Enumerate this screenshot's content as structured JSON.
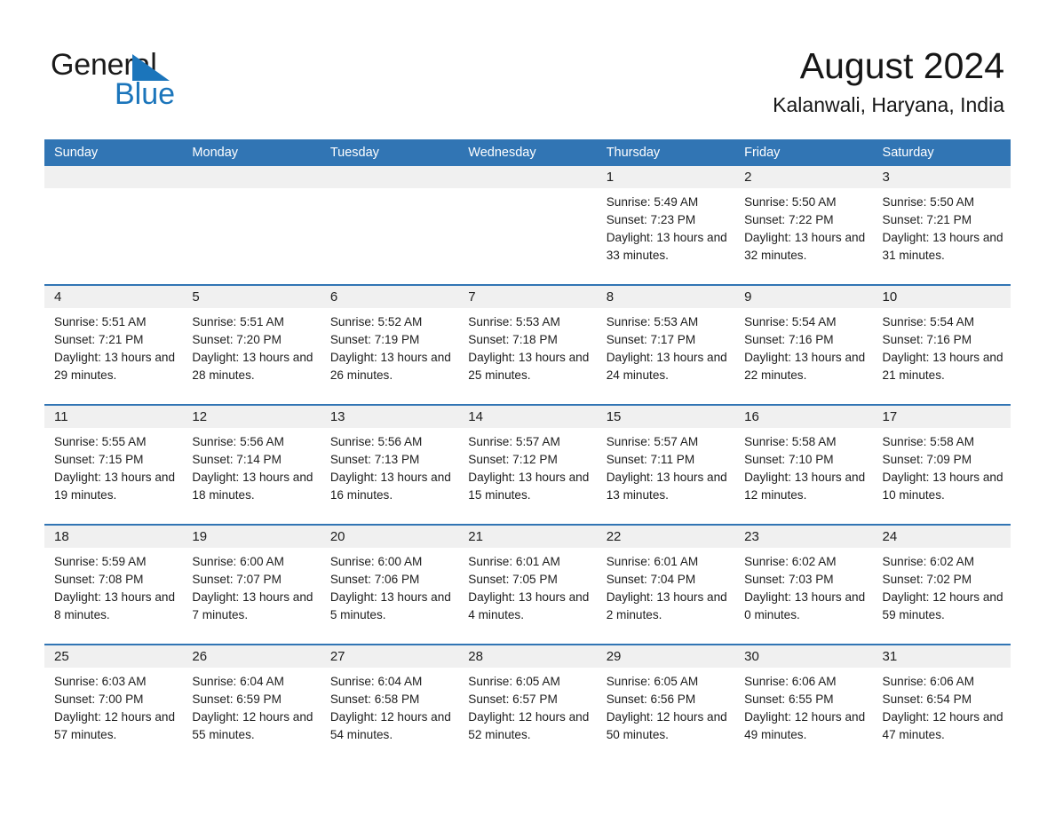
{
  "brand": {
    "name_part1": "General",
    "name_part2": "Blue",
    "triangle_icon": "triangle-icon",
    "accent_color": "#1b75bb"
  },
  "header": {
    "month_title": "August 2024",
    "location": "Kalanwali, Haryana, India"
  },
  "theme": {
    "header_blue": "#3175b4",
    "daynum_band": "#f0f0f0",
    "text": "#1d1d1d"
  },
  "calendar": {
    "weekday_headers": [
      "Sunday",
      "Monday",
      "Tuesday",
      "Wednesday",
      "Thursday",
      "Friday",
      "Saturday"
    ],
    "weeks": [
      [
        {
          "day": "",
          "empty": true,
          "info": ""
        },
        {
          "day": "",
          "empty": true,
          "info": ""
        },
        {
          "day": "",
          "empty": true,
          "info": ""
        },
        {
          "day": "",
          "empty": true,
          "info": ""
        },
        {
          "day": "1",
          "empty": false,
          "info": "Sunrise: 5:49 AM\nSunset: 7:23 PM\nDaylight: 13 hours and 33 minutes."
        },
        {
          "day": "2",
          "empty": false,
          "info": "Sunrise: 5:50 AM\nSunset: 7:22 PM\nDaylight: 13 hours and 32 minutes."
        },
        {
          "day": "3",
          "empty": false,
          "info": "Sunrise: 5:50 AM\nSunset: 7:21 PM\nDaylight: 13 hours and 31 minutes."
        }
      ],
      [
        {
          "day": "4",
          "empty": false,
          "info": "Sunrise: 5:51 AM\nSunset: 7:21 PM\nDaylight: 13 hours and 29 minutes."
        },
        {
          "day": "5",
          "empty": false,
          "info": "Sunrise: 5:51 AM\nSunset: 7:20 PM\nDaylight: 13 hours and 28 minutes."
        },
        {
          "day": "6",
          "empty": false,
          "info": "Sunrise: 5:52 AM\nSunset: 7:19 PM\nDaylight: 13 hours and 26 minutes."
        },
        {
          "day": "7",
          "empty": false,
          "info": "Sunrise: 5:53 AM\nSunset: 7:18 PM\nDaylight: 13 hours and 25 minutes."
        },
        {
          "day": "8",
          "empty": false,
          "info": "Sunrise: 5:53 AM\nSunset: 7:17 PM\nDaylight: 13 hours and 24 minutes."
        },
        {
          "day": "9",
          "empty": false,
          "info": "Sunrise: 5:54 AM\nSunset: 7:16 PM\nDaylight: 13 hours and 22 minutes."
        },
        {
          "day": "10",
          "empty": false,
          "info": "Sunrise: 5:54 AM\nSunset: 7:16 PM\nDaylight: 13 hours and 21 minutes."
        }
      ],
      [
        {
          "day": "11",
          "empty": false,
          "info": "Sunrise: 5:55 AM\nSunset: 7:15 PM\nDaylight: 13 hours and 19 minutes."
        },
        {
          "day": "12",
          "empty": false,
          "info": "Sunrise: 5:56 AM\nSunset: 7:14 PM\nDaylight: 13 hours and 18 minutes."
        },
        {
          "day": "13",
          "empty": false,
          "info": "Sunrise: 5:56 AM\nSunset: 7:13 PM\nDaylight: 13 hours and 16 minutes."
        },
        {
          "day": "14",
          "empty": false,
          "info": "Sunrise: 5:57 AM\nSunset: 7:12 PM\nDaylight: 13 hours and 15 minutes."
        },
        {
          "day": "15",
          "empty": false,
          "info": "Sunrise: 5:57 AM\nSunset: 7:11 PM\nDaylight: 13 hours and 13 minutes."
        },
        {
          "day": "16",
          "empty": false,
          "info": "Sunrise: 5:58 AM\nSunset: 7:10 PM\nDaylight: 13 hours and 12 minutes."
        },
        {
          "day": "17",
          "empty": false,
          "info": "Sunrise: 5:58 AM\nSunset: 7:09 PM\nDaylight: 13 hours and 10 minutes."
        }
      ],
      [
        {
          "day": "18",
          "empty": false,
          "info": "Sunrise: 5:59 AM\nSunset: 7:08 PM\nDaylight: 13 hours and 8 minutes."
        },
        {
          "day": "19",
          "empty": false,
          "info": "Sunrise: 6:00 AM\nSunset: 7:07 PM\nDaylight: 13 hours and 7 minutes."
        },
        {
          "day": "20",
          "empty": false,
          "info": "Sunrise: 6:00 AM\nSunset: 7:06 PM\nDaylight: 13 hours and 5 minutes."
        },
        {
          "day": "21",
          "empty": false,
          "info": "Sunrise: 6:01 AM\nSunset: 7:05 PM\nDaylight: 13 hours and 4 minutes."
        },
        {
          "day": "22",
          "empty": false,
          "info": "Sunrise: 6:01 AM\nSunset: 7:04 PM\nDaylight: 13 hours and 2 minutes."
        },
        {
          "day": "23",
          "empty": false,
          "info": "Sunrise: 6:02 AM\nSunset: 7:03 PM\nDaylight: 13 hours and 0 minutes."
        },
        {
          "day": "24",
          "empty": false,
          "info": "Sunrise: 6:02 AM\nSunset: 7:02 PM\nDaylight: 12 hours and 59 minutes."
        }
      ],
      [
        {
          "day": "25",
          "empty": false,
          "info": "Sunrise: 6:03 AM\nSunset: 7:00 PM\nDaylight: 12 hours and 57 minutes."
        },
        {
          "day": "26",
          "empty": false,
          "info": "Sunrise: 6:04 AM\nSunset: 6:59 PM\nDaylight: 12 hours and 55 minutes."
        },
        {
          "day": "27",
          "empty": false,
          "info": "Sunrise: 6:04 AM\nSunset: 6:58 PM\nDaylight: 12 hours and 54 minutes."
        },
        {
          "day": "28",
          "empty": false,
          "info": "Sunrise: 6:05 AM\nSunset: 6:57 PM\nDaylight: 12 hours and 52 minutes."
        },
        {
          "day": "29",
          "empty": false,
          "info": "Sunrise: 6:05 AM\nSunset: 6:56 PM\nDaylight: 12 hours and 50 minutes."
        },
        {
          "day": "30",
          "empty": false,
          "info": "Sunrise: 6:06 AM\nSunset: 6:55 PM\nDaylight: 12 hours and 49 minutes."
        },
        {
          "day": "31",
          "empty": false,
          "info": "Sunrise: 6:06 AM\nSunset: 6:54 PM\nDaylight: 12 hours and 47 minutes."
        }
      ]
    ]
  }
}
